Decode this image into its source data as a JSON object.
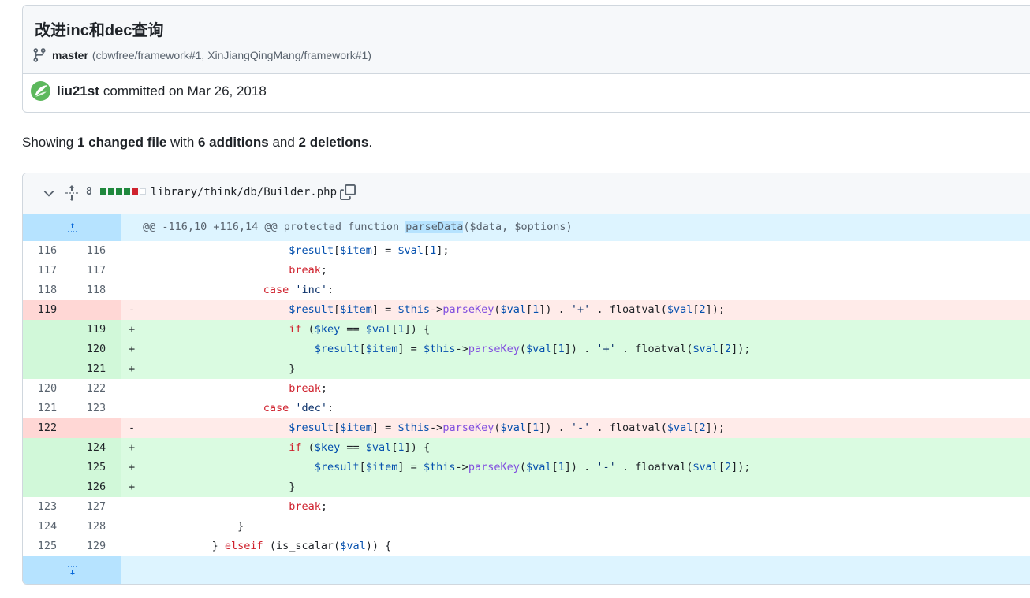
{
  "commit": {
    "title": "改进inc和dec查询",
    "branch": "master",
    "refs": "(cbwfree/framework#1, XinJiangQingMang/framework#1)",
    "author": "liu21st",
    "committed_text": "committed on Mar 26, 2018"
  },
  "summary": {
    "prefix": "Showing ",
    "changed": "1 changed file",
    "with": " with ",
    "additions": "6 additions",
    "and": " and ",
    "deletions": "2 deletions",
    "end": "."
  },
  "file": {
    "change_count": "8",
    "path": "library/think/db/Builder.php",
    "diffstat": [
      "add",
      "add",
      "add",
      "add",
      "del",
      "neutral"
    ]
  },
  "hunk": {
    "prefix": "@@ -116,10 +116,14 @@ protected function ",
    "highlight": "parseData",
    "suffix": "($data, $options)"
  },
  "lines": [
    {
      "type": "ctx",
      "old": "116",
      "new": "116",
      "marker": "",
      "code": "                        $result[$item] = $val[1];"
    },
    {
      "type": "ctx",
      "old": "117",
      "new": "117",
      "marker": "",
      "code": "                        break;"
    },
    {
      "type": "ctx",
      "old": "118",
      "new": "118",
      "marker": "",
      "code": "                    case 'inc':"
    },
    {
      "type": "del",
      "old": "119",
      "new": "",
      "marker": "-",
      "code": "                        $result[$item] = $this->parseKey($val[1]) . '+' . floatval($val[2]);"
    },
    {
      "type": "add",
      "old": "",
      "new": "119",
      "marker": "+",
      "code": "                        if ($key == $val[1]) {"
    },
    {
      "type": "add",
      "old": "",
      "new": "120",
      "marker": "+",
      "code": "                            $result[$item] = $this->parseKey($val[1]) . '+' . floatval($val[2]);"
    },
    {
      "type": "add",
      "old": "",
      "new": "121",
      "marker": "+",
      "code": "                        }"
    },
    {
      "type": "ctx",
      "old": "120",
      "new": "122",
      "marker": "",
      "code": "                        break;"
    },
    {
      "type": "ctx",
      "old": "121",
      "new": "123",
      "marker": "",
      "code": "                    case 'dec':"
    },
    {
      "type": "del",
      "old": "122",
      "new": "",
      "marker": "-",
      "code": "                        $result[$item] = $this->parseKey($val[1]) . '-' . floatval($val[2]);"
    },
    {
      "type": "add",
      "old": "",
      "new": "124",
      "marker": "+",
      "code": "                        if ($key == $val[1]) {"
    },
    {
      "type": "add",
      "old": "",
      "new": "125",
      "marker": "+",
      "code": "                            $result[$item] = $this->parseKey($val[1]) . '-' . floatval($val[2]);"
    },
    {
      "type": "add",
      "old": "",
      "new": "126",
      "marker": "+",
      "code": "                        }"
    },
    {
      "type": "ctx",
      "old": "123",
      "new": "127",
      "marker": "",
      "code": "                        break;"
    },
    {
      "type": "ctx",
      "old": "124",
      "new": "128",
      "marker": "",
      "code": "                }"
    },
    {
      "type": "ctx",
      "old": "125",
      "new": "129",
      "marker": "",
      "code": "            } elseif (is_scalar($val)) {"
    }
  ],
  "colors": {
    "addition": "#1f883d",
    "deletion": "#cf222e",
    "accent": "#0969da"
  }
}
